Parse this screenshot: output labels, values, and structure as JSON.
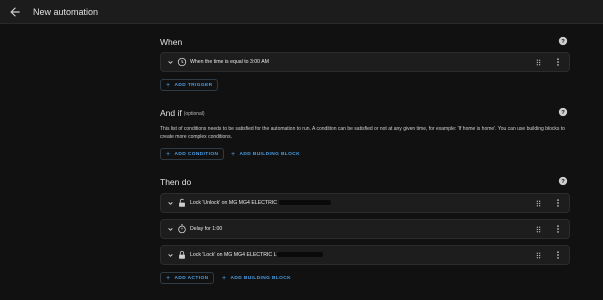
{
  "header": {
    "title": "New automation"
  },
  "when": {
    "title": "When",
    "trigger_label": "When the time is equal to 3:00 AM",
    "add_trigger_label": "ADD TRIGGER"
  },
  "and_if": {
    "title": "And if",
    "optional_label": "(optional)",
    "description": "This list of conditions needs to be satisfied for the automation to run. A condition can be satisfied or not at any given time, for example: 'If home is home'. You can use building blocks to create more complex conditions.",
    "add_condition_label": "ADD CONDITION",
    "add_building_block_label": "ADD BUILDING BLOCK"
  },
  "then_do": {
    "title": "Then do",
    "actions": [
      {
        "label": "Lock 'Unlock' on MG MG4 ELECTRIC ",
        "icon": "lock-open-icon"
      },
      {
        "label": "Delay for 1:00",
        "icon": "timer-icon"
      },
      {
        "label": "Lock 'Lock' on MG MG4 ELECTRIC L",
        "icon": "lock-icon"
      }
    ],
    "add_action_label": "ADD ACTION",
    "add_building_block_label": "ADD BUILDING BLOCK"
  },
  "colors": {
    "accent": "#4a9fe7",
    "background": "#111111",
    "card": "#1d1d1d"
  }
}
